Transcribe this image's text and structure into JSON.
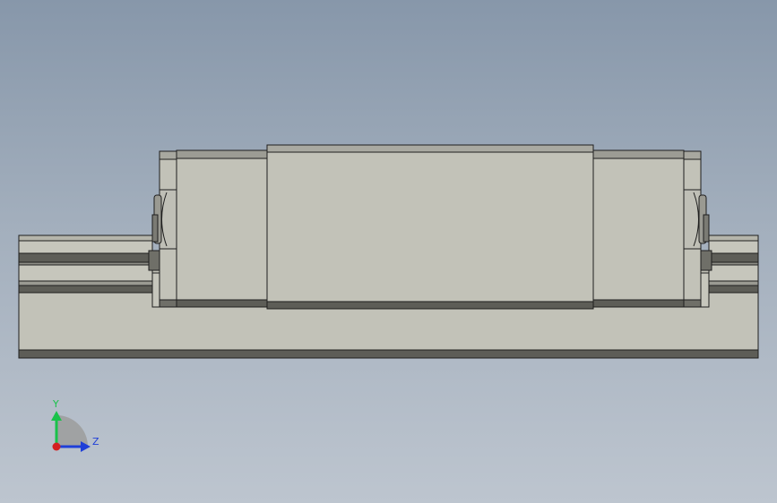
{
  "viewport": {
    "background_top": "#8797aa",
    "background_bottom": "#bdc5cf"
  },
  "model": {
    "face_color": "#c2c2b8",
    "face_light": "#c9c9bf",
    "edge_color": "#1e1e1e",
    "band_dark": "#5d5d57",
    "band_mid": "#7b7b74"
  },
  "triad": {
    "y_label": "Y",
    "z_label": "Z",
    "y_color": "#19c24a",
    "z_color": "#1f3fd8",
    "x_color": "#d42020",
    "icon": "view-orientation-triad-icon"
  }
}
